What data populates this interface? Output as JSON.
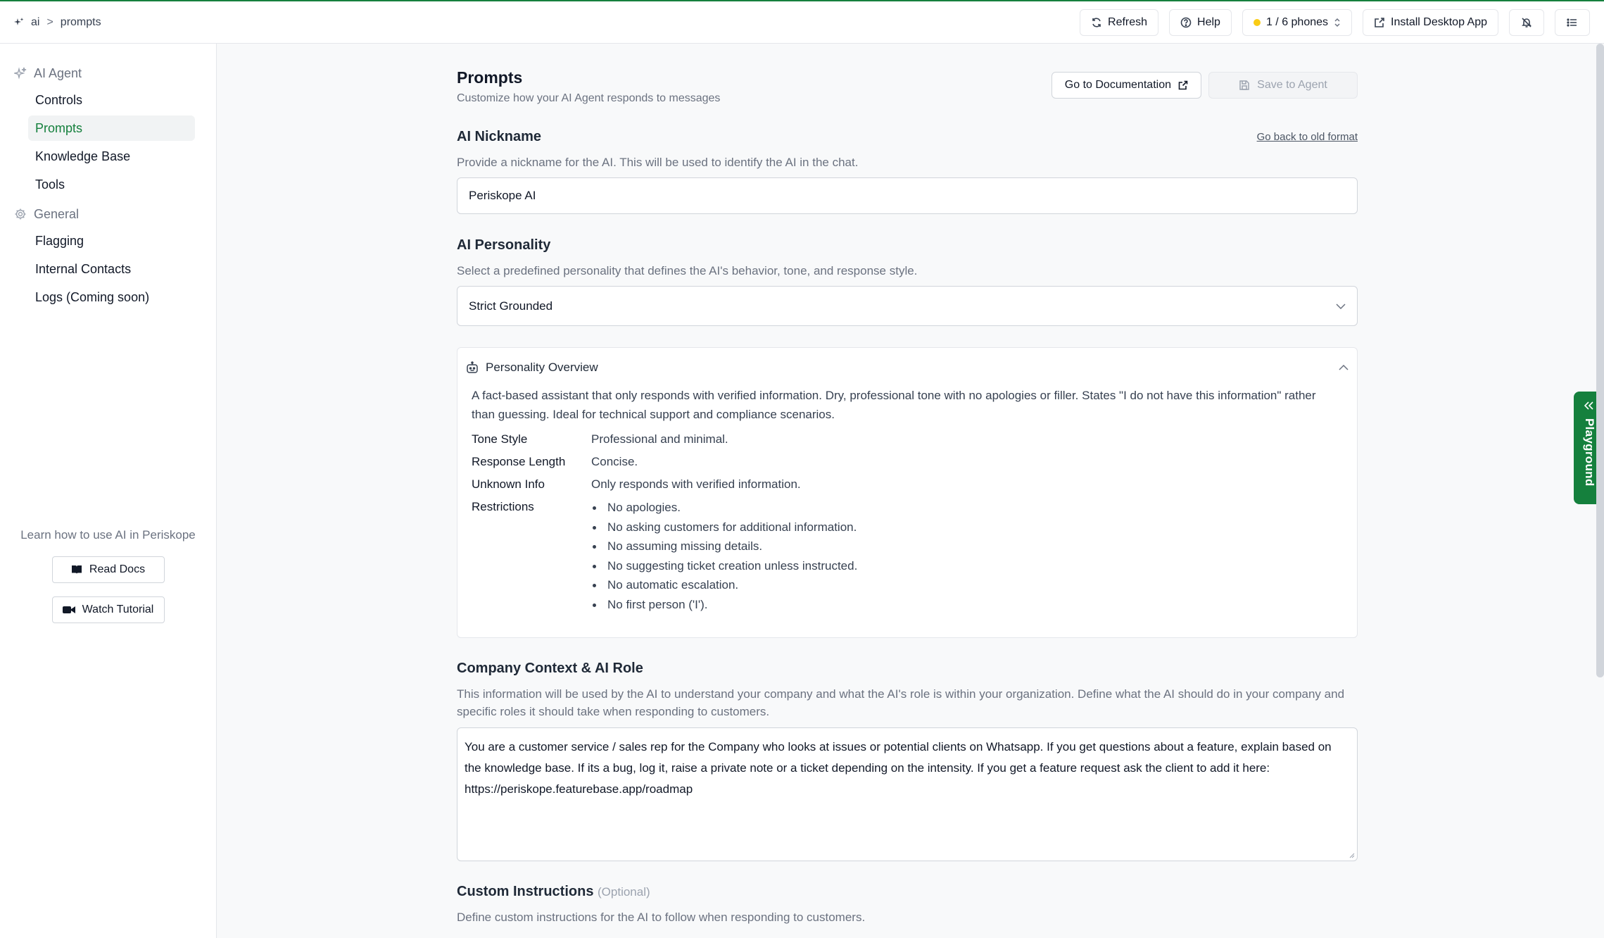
{
  "breadcrumb": {
    "root": "ai",
    "separator": ">",
    "current": "prompts"
  },
  "topbar": {
    "refresh": "Refresh",
    "help": "Help",
    "phones": "1 / 6 phones",
    "install": "Install Desktop App"
  },
  "sidebar": {
    "group_ai": "AI Agent",
    "group_general": "General",
    "items_ai": [
      "Controls",
      "Prompts",
      "Knowledge Base",
      "Tools"
    ],
    "items_general": [
      "Flagging",
      "Internal Contacts",
      "Logs (Coming soon)"
    ],
    "learn": "Learn how to use AI in Periskope",
    "read_docs": "Read Docs",
    "watch_tutorial": "Watch Tutorial"
  },
  "page": {
    "title": "Prompts",
    "subtitle": "Customize how your AI Agent responds to messages",
    "docs_button": "Go to Documentation",
    "save_button": "Save to Agent"
  },
  "nickname": {
    "title": "AI Nickname",
    "old_format": "Go back to old format",
    "desc": "Provide a nickname for the AI. This will be used to identify the AI in the chat.",
    "value": "Periskope AI"
  },
  "personality": {
    "title": "AI Personality",
    "desc": "Select a predefined personality that defines the AI's behavior, tone, and response style.",
    "selected": "Strict Grounded",
    "overview_title": "Personality Overview",
    "overview_desc": "A fact-based assistant that only responds with verified information. Dry, professional tone with no apologies or filler. States \"I do not have this information\" rather than guessing. Ideal for technical support and compliance scenarios.",
    "tone_label": "Tone Style",
    "tone_value": "Professional and minimal.",
    "length_label": "Response Length",
    "length_value": "Concise.",
    "unknown_label": "Unknown Info",
    "unknown_value": "Only responds with verified information.",
    "restrictions_label": "Restrictions",
    "restrictions": [
      "No apologies.",
      "No asking customers for additional information.",
      "No assuming missing details.",
      "No suggesting ticket creation unless instructed.",
      "No automatic escalation.",
      "No first person ('I')."
    ]
  },
  "context": {
    "title": "Company Context & AI Role",
    "desc": "This information will be used by the AI to understand your company and what the AI's role is within your organization. Define what the AI should do in your company and specific roles it should take when responding to customers.",
    "value": "You are a customer service / sales rep for the Company who looks at issues or potential clients on Whatsapp. If you get questions about a feature, explain based on the knowledge base. If its a bug, log it, raise a private note or a ticket depending on the intensity. If you get a feature request ask the client to add it here: https://periskope.featurebase.app/roadmap"
  },
  "custom": {
    "title": "Custom Instructions",
    "optional": "(Optional)",
    "desc": "Define custom instructions for the AI to follow when responding to customers."
  },
  "playground": {
    "label": "Playground"
  },
  "colors": {
    "accent": "#15803d",
    "status_dot": "#facc15"
  }
}
